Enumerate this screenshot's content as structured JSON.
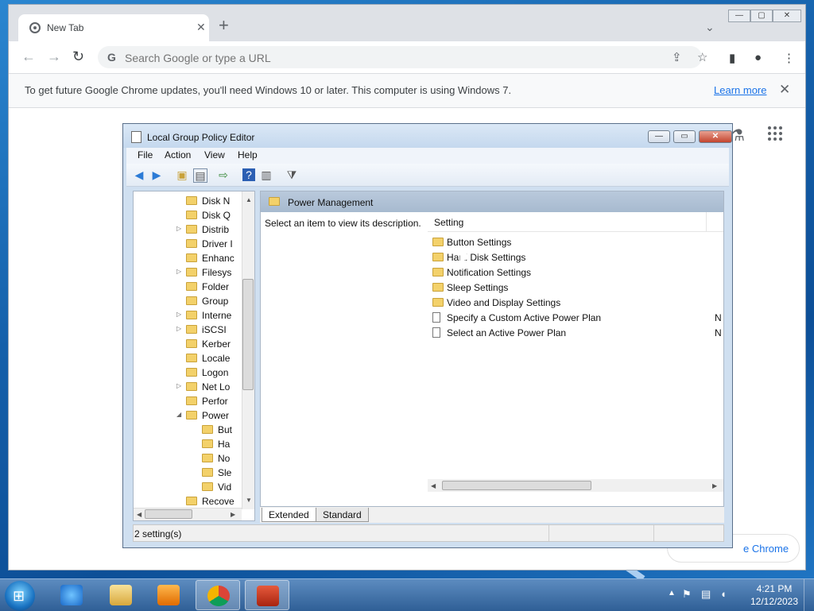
{
  "chrome": {
    "tab_title": "New Tab",
    "tab_close": "✕",
    "new_tab": "+",
    "tab_search": "⌄",
    "omnibox_placeholder": "Search Google or type a URL",
    "infobar_message": "To get future Google Chrome updates, you'll need Windows 10 or later. This computer is using Windows 7.",
    "learn_more": "Learn more",
    "infobar_close": "✕",
    "customize_label": "e Chrome"
  },
  "gpedit": {
    "window_title": "Local Group Policy Editor",
    "menu": [
      "File",
      "Action",
      "View",
      "Help"
    ],
    "tree_items": [
      {
        "label": "Disk N",
        "expander": "",
        "indent": 1
      },
      {
        "label": "Disk Q",
        "expander": "",
        "indent": 1
      },
      {
        "label": "Distrib",
        "expander": "▷",
        "indent": 1
      },
      {
        "label": "Driver I",
        "expander": "",
        "indent": 1
      },
      {
        "label": "Enhanc",
        "expander": "",
        "indent": 1
      },
      {
        "label": "Filesys",
        "expander": "▷",
        "indent": 1
      },
      {
        "label": "Folder",
        "expander": "",
        "indent": 1
      },
      {
        "label": "Group",
        "expander": "",
        "indent": 1
      },
      {
        "label": "Interne",
        "expander": "▷",
        "indent": 1
      },
      {
        "label": "iSCSI",
        "expander": "▷",
        "indent": 1
      },
      {
        "label": "Kerber",
        "expander": "",
        "indent": 1
      },
      {
        "label": "Locale",
        "expander": "",
        "indent": 1
      },
      {
        "label": "Logon",
        "expander": "",
        "indent": 1
      },
      {
        "label": "Net Lo",
        "expander": "▷",
        "indent": 1
      },
      {
        "label": "Perfor",
        "expander": "",
        "indent": 1
      },
      {
        "label": "Power",
        "expander": "◢",
        "indent": 1
      },
      {
        "label": "But",
        "expander": "",
        "indent": 2
      },
      {
        "label": "Ha",
        "expander": "",
        "indent": 2
      },
      {
        "label": "No",
        "expander": "",
        "indent": 2
      },
      {
        "label": "Sle",
        "expander": "",
        "indent": 2
      },
      {
        "label": "Vid",
        "expander": "",
        "indent": 2
      },
      {
        "label": "Recove",
        "expander": "",
        "indent": 1
      }
    ],
    "detail_header": "Power Management",
    "description": "Select an item to view its description.",
    "column_setting": "Setting",
    "settings": [
      {
        "label": "Button Settings",
        "kind": "folder",
        "state": ""
      },
      {
        "label": "Hard Disk Settings",
        "kind": "folder",
        "state": ""
      },
      {
        "label": "Notification Settings",
        "kind": "folder",
        "state": ""
      },
      {
        "label": "Sleep Settings",
        "kind": "folder",
        "state": ""
      },
      {
        "label": "Video and Display Settings",
        "kind": "folder",
        "state": ""
      },
      {
        "label": "Specify a Custom Active Power Plan",
        "kind": "policy",
        "state": "N"
      },
      {
        "label": "Select an Active Power Plan",
        "kind": "policy",
        "state": "N"
      }
    ],
    "tab_extended": "Extended",
    "tab_standard": "Standard",
    "status_text": "2 setting(s)"
  },
  "taskbar": {
    "time": "4:21 PM",
    "date": "12/12/2023"
  },
  "colors": {
    "chrome_link": "#1a73e8",
    "folder_yellow": "#f3d16a",
    "taskbar_blue": "#2f5f96"
  }
}
